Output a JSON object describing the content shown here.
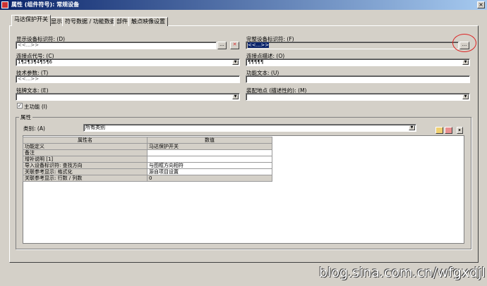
{
  "window": {
    "title": "属性 (组件符号): 常规设备",
    "close": "×"
  },
  "tabs": [
    "马达保护开关",
    "显示",
    "符号数据 / 功能数据",
    "部件",
    "触点映像设置"
  ],
  "left": {
    "display_id_label": "显示设备标识符: (D)",
    "display_id_value": "<<...>>",
    "conn_code_label": "连接点代号: (C)",
    "conn_code_value": "1¶2¶3¶4¶5¶6",
    "tech_label": "技术参数: (T)",
    "tech_value": "<<...>>",
    "nameplate_label": "铭牌文本: (E)",
    "nameplate_value": "",
    "main_func_label": "主功能 (I)"
  },
  "right": {
    "full_id_label": "完整设备标识符: (F)",
    "full_id_value": "<<...>>",
    "conn_desc_label": "连接点描述: (O)",
    "conn_desc_value": "¶¶¶¶¶",
    "func_text_label": "功能文本: (U)",
    "func_text_value": "",
    "mount_label": "装配地点 (描述性的): (M)",
    "mount_value": ""
  },
  "buttons": {
    "browse": "...",
    "delete": "✕"
  },
  "properties": {
    "group_label": "属性",
    "category_label": "类别: (A)",
    "category_value": "所有类别",
    "headers": [
      "属性名",
      "数值"
    ],
    "rows": [
      [
        "功能定义",
        "马达保护开关"
      ],
      [
        "备注",
        ""
      ],
      [
        "增补说明 [1]",
        ""
      ],
      [
        "导入设备标识符: 查找方向",
        "与图框方向相符"
      ],
      [
        "关联参考显示: 格式化",
        "源自项目设置"
      ],
      [
        "关联参考显示: 行数 / 列数",
        "0"
      ]
    ]
  },
  "watermark": "blog.sina.com.cn/wfgxdjl"
}
